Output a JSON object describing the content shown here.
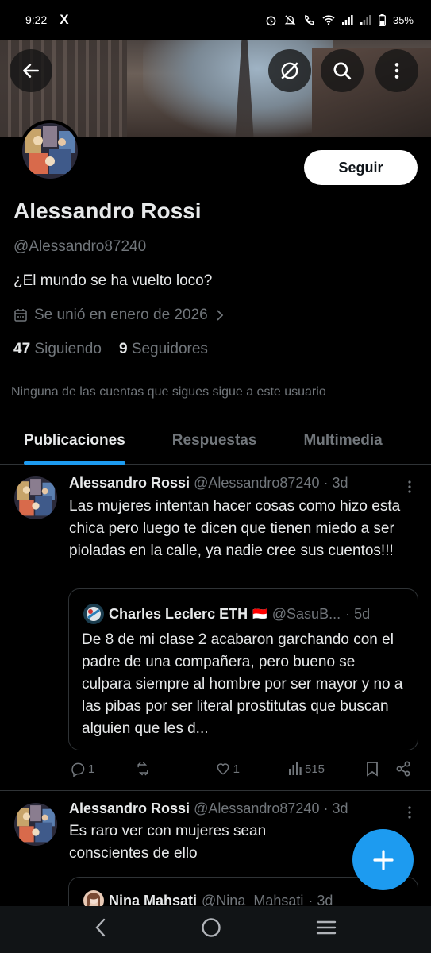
{
  "status_bar": {
    "time": "9:22",
    "app_glyph": "X",
    "battery": "35%"
  },
  "header": {
    "back_icon": "arrow-left-icon",
    "right_icons": [
      "grok-icon",
      "search-icon",
      "more-vertical-icon"
    ]
  },
  "profile": {
    "follow_label": "Seguir",
    "name": "Alessandro Rossi",
    "handle": "@Alessandro87240",
    "bio": "¿El mundo se ha vuelto loco?",
    "joined": "Se unió en enero de 2026",
    "following_count": "47",
    "following_label": "Siguiendo",
    "followers_count": "9",
    "followers_label": "Seguidores",
    "mutuals_note": "Ninguna de las cuentas que sigues sigue a este usuario"
  },
  "tabs": [
    {
      "label": "Publicaciones",
      "active": true
    },
    {
      "label": "Respuestas",
      "active": false
    },
    {
      "label": "Multimedia",
      "active": false
    }
  ],
  "posts": [
    {
      "name": "Alessandro Rossi",
      "handle": "@Alessandro87240 · 3d",
      "text": "Las mujeres intentan hacer cosas como hizo esta chica pero luego te dicen que tienen miedo a ser pioladas en la calle, ya nadie cree sus cuentos!!!",
      "quote": {
        "name": "Charles Leclerc ETH",
        "flag": "🇮🇩",
        "handle": "@SasuB...",
        "time": "· 5d",
        "text": "De 8 de mi clase 2 acabaron garchando con el padre de una compañera, pero bueno se culpara siempre al hombre por ser mayor y no a las pibas por ser literal prostitutas que buscan alguien que les d..."
      },
      "replies": "1",
      "reposts": "",
      "likes": "1",
      "views": "515"
    },
    {
      "name": "Alessandro Rossi",
      "handle": "@Alessandro87240 · 3d",
      "text": "Es raro ver con mujeres sean conscientes de ello",
      "quote": {
        "name": "Nina Mahsati",
        "handle": "@Nina_Mahsati",
        "time": "· 3d"
      }
    }
  ],
  "colors": {
    "accent": "#1d9bf0",
    "muted": "#71767b",
    "text": "#e7e9ea",
    "divider": "#2f3336"
  }
}
